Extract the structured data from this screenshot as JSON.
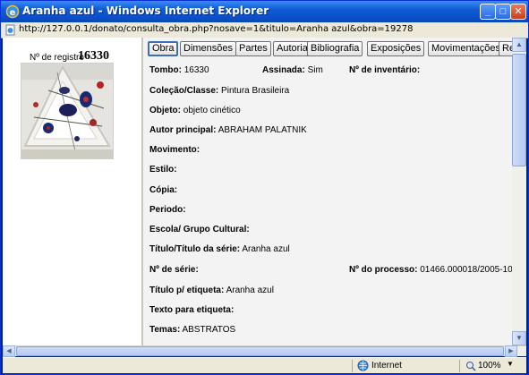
{
  "window": {
    "title": "Aranha azul - Windows Internet Explorer",
    "min_glyph": "_",
    "max_glyph": "□",
    "close_glyph": "✕"
  },
  "address": {
    "url": "http://127.0.0.1/donato/consulta_obra.php?nosave=1&titulo=Aranha azul&obra=19278"
  },
  "record": {
    "reg_label": "Nº de registro",
    "reg_value": "16330"
  },
  "tabs": [
    {
      "label": "Obra",
      "active": true
    },
    {
      "label": "Dimensões"
    },
    {
      "label": "Partes"
    },
    {
      "label": "Autoria"
    },
    {
      "label": "Bibliografia"
    },
    {
      "label": "Exposições"
    },
    {
      "label": "Movimentações"
    },
    {
      "label": "Rela"
    }
  ],
  "fields": {
    "tombo": {
      "label": "Tombo:",
      "value": "16330"
    },
    "assinada": {
      "label": "Assinada:",
      "value": "Sim"
    },
    "inventario": {
      "label": "Nº de inventário:",
      "value": ""
    },
    "colecao": {
      "label": "Coleção/Classe:",
      "value": "Pintura Brasileira"
    },
    "objeto": {
      "label": "Objeto:",
      "value": "objeto cinético"
    },
    "autor": {
      "label": "Autor principal:",
      "value": "ABRAHAM PALATNIK"
    },
    "movimento": {
      "label": "Movimento:",
      "value": ""
    },
    "estilo": {
      "label": "Estilo:",
      "value": ""
    },
    "copia": {
      "label": "Cópia:",
      "value": ""
    },
    "periodo": {
      "label": "Periodo:",
      "value": ""
    },
    "escola": {
      "label": "Escola/ Grupo Cultural:",
      "value": ""
    },
    "titulo_serie": {
      "label": "Título/Título da série:",
      "value": "Aranha azul"
    },
    "num_serie": {
      "label": "Nº de série:",
      "value": ""
    },
    "num_processo": {
      "label": "Nº do processo:",
      "value": "01466.000018/2005-10"
    },
    "titulo_etiqueta": {
      "label": "Título p/ etiqueta:",
      "value": "Aranha azul"
    },
    "texto_etiqueta": {
      "label": "Texto para etiqueta:",
      "value": ""
    },
    "temas": {
      "label": "Temas:",
      "value": "ABSTRATOS"
    }
  },
  "status": {
    "zone": "Internet",
    "zoom": "100%"
  },
  "icons": {
    "app": "ie-icon",
    "page": "page-icon",
    "zone": "globe-icon",
    "zoom": "zoom-icon"
  }
}
